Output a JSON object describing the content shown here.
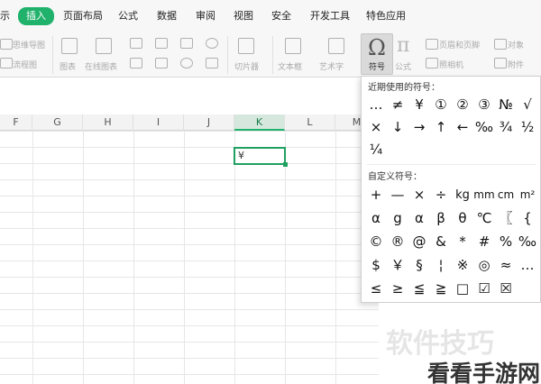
{
  "menu": {
    "tabs": [
      {
        "label": "示"
      },
      {
        "label": "插入",
        "active": true
      },
      {
        "label": "页面布局"
      },
      {
        "label": "公式"
      },
      {
        "label": "数据"
      },
      {
        "label": "审阅"
      },
      {
        "label": "视图"
      },
      {
        "label": "安全"
      },
      {
        "label": "开发工具"
      },
      {
        "label": "特色应用"
      }
    ]
  },
  "ribbon": {
    "mind_map": "思维导图",
    "flowchart": "流程图",
    "chart": "图表",
    "online_chart": "在线图表",
    "slicer": "切片器",
    "textbox": "文本框",
    "wordart": "艺术字",
    "symbol": "符号",
    "formula": "公式",
    "header_footer": "页眉和页脚",
    "object": "对象",
    "camera": "照相机",
    "attachment": "附件"
  },
  "columns": [
    "F",
    "G",
    "H",
    "I",
    "J",
    "K",
    "L",
    "M"
  ],
  "selected_column": "K",
  "active_cell": {
    "value": "¥"
  },
  "symbol_popup": {
    "recent_label": "近期使用的符号：",
    "recent": [
      "…",
      "≠",
      "¥",
      "①",
      "②",
      "③",
      "№",
      "√",
      "×",
      "↓",
      "→",
      "↑",
      "←",
      "‰",
      "¾",
      "½",
      "¼"
    ],
    "custom_label": "自定义符号：",
    "custom": [
      "+",
      "—",
      "×",
      "÷",
      "kg",
      "mm",
      "cm",
      "m²",
      "α",
      "g",
      "α",
      "β",
      "θ",
      "℃",
      "〖",
      "{",
      "©",
      "®",
      "@",
      "&",
      "*",
      "#",
      "%",
      "‰",
      "$",
      "￥",
      "§",
      "¦",
      "※",
      "◎",
      "≈",
      "…",
      "≤",
      "≥",
      "≦",
      "≧",
      "□",
      "☑",
      "☒"
    ]
  },
  "watermark": {
    "faint": "软件技巧",
    "brand": "看看手游网"
  },
  "colors": {
    "accent": "#20b16b",
    "selection": "#20a060"
  }
}
